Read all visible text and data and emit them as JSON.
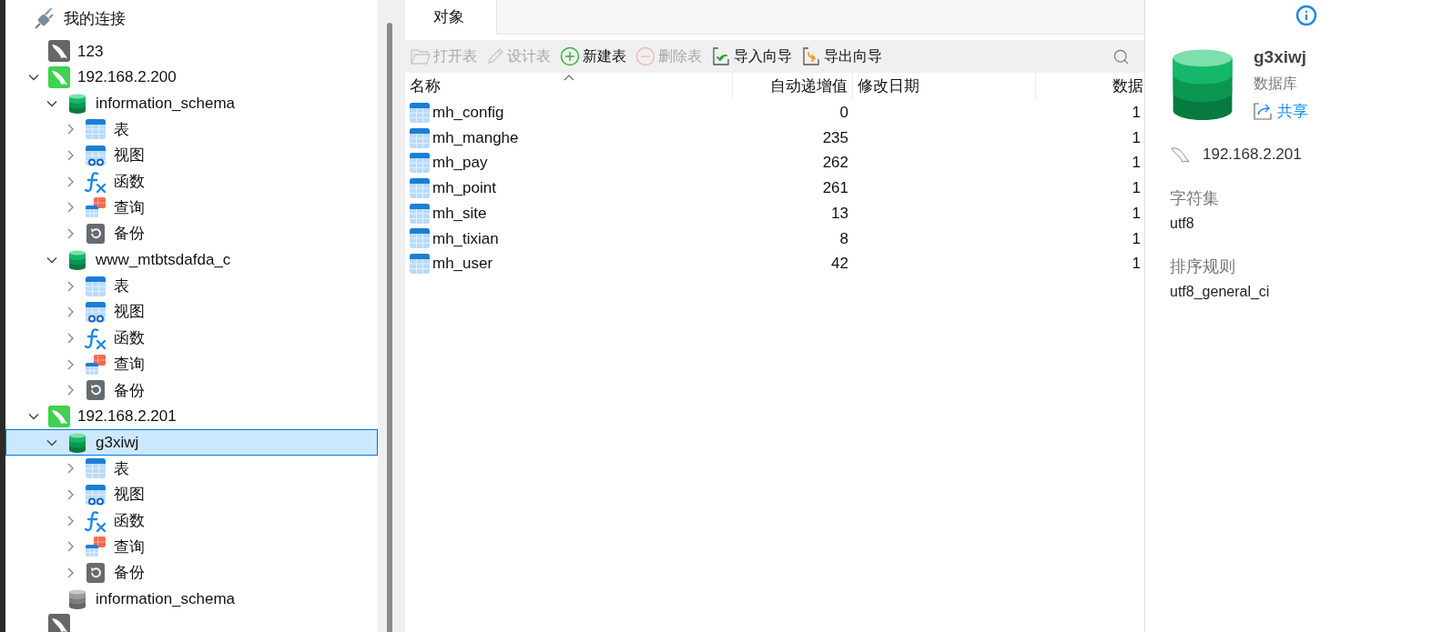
{
  "tree": {
    "root": {
      "label": "我的连接"
    },
    "items": [
      {
        "kind": "connection",
        "label": "123",
        "connected": false,
        "selected": false
      },
      {
        "kind": "connection",
        "label": "192.168.2.200",
        "connected": true,
        "expanded": true,
        "selected": false,
        "children": [
          {
            "kind": "database",
            "label": "information_schema",
            "open": true,
            "expanded": true,
            "selected": false,
            "children": [
              {
                "kind": "table",
                "label": "表",
                "expanded": false,
                "selected": false
              },
              {
                "kind": "view",
                "label": "视图",
                "expanded": false,
                "selected": false
              },
              {
                "kind": "function",
                "label": "函数",
                "expanded": false,
                "selected": false
              },
              {
                "kind": "query",
                "label": "查询",
                "expanded": false,
                "selected": false
              },
              {
                "kind": "backup",
                "label": "备份",
                "expanded": false,
                "selected": false
              }
            ]
          },
          {
            "kind": "database",
            "label": "www_mtbtsdafda_c",
            "open": true,
            "expanded": true,
            "selected": false,
            "children": [
              {
                "kind": "table",
                "label": "表",
                "expanded": false,
                "selected": false
              },
              {
                "kind": "view",
                "label": "视图",
                "expanded": false,
                "selected": false
              },
              {
                "kind": "function",
                "label": "函数",
                "expanded": false,
                "selected": false
              },
              {
                "kind": "query",
                "label": "查询",
                "expanded": false,
                "selected": false
              },
              {
                "kind": "backup",
                "label": "备份",
                "expanded": false,
                "selected": false
              }
            ]
          }
        ]
      },
      {
        "kind": "connection",
        "label": "192.168.2.201",
        "connected": true,
        "expanded": true,
        "selected": false,
        "children": [
          {
            "kind": "database",
            "label": "g3xiwj",
            "open": true,
            "expanded": true,
            "selected": true,
            "children": [
              {
                "kind": "table",
                "label": "表",
                "expanded": false,
                "selected": false
              },
              {
                "kind": "view",
                "label": "视图",
                "expanded": false,
                "selected": false
              },
              {
                "kind": "function",
                "label": "函数",
                "expanded": false,
                "selected": false
              },
              {
                "kind": "query",
                "label": "查询",
                "expanded": false,
                "selected": false
              },
              {
                "kind": "backup",
                "label": "备份",
                "expanded": false,
                "selected": false
              }
            ]
          },
          {
            "kind": "database",
            "label": "information_schema",
            "open": false,
            "selected": false
          }
        ]
      },
      {
        "kind": "connection",
        "connected": false,
        "selected": false
      }
    ]
  },
  "tabs": [
    {
      "label": "对象",
      "selected": true
    }
  ],
  "toolbar": [
    {
      "kind": "open",
      "label": "打开表",
      "disabled": true
    },
    {
      "kind": "design",
      "label": "设计表",
      "disabled": true
    },
    {
      "kind": "new",
      "label": "新建表",
      "disabled": false
    },
    {
      "kind": "delete",
      "label": "删除表",
      "disabled": true
    },
    {
      "kind": "import",
      "label": "导入向导",
      "disabled": false
    },
    {
      "kind": "export",
      "label": "导出向导",
      "disabled": false
    }
  ],
  "table": {
    "columns": [
      {
        "label": "名称",
        "kind": "text",
        "sorted": true
      },
      {
        "label": "自动递增值",
        "kind": "number",
        "sorted": false
      },
      {
        "label": "修改日期",
        "kind": "text",
        "sorted": false
      },
      {
        "label": "数据",
        "kind": "number",
        "sorted": false
      }
    ],
    "rows": [
      [
        "mh_config",
        "0",
        "",
        "1"
      ],
      [
        "mh_manghe",
        "235",
        "",
        "1"
      ],
      [
        "mh_pay",
        "262",
        "",
        "1"
      ],
      [
        "mh_point",
        "261",
        "",
        "1"
      ],
      [
        "mh_site",
        "13",
        "",
        "1"
      ],
      [
        "mh_tixian",
        "8",
        "",
        "1"
      ],
      [
        "mh_user",
        "42",
        "",
        "1"
      ]
    ]
  },
  "info": {
    "name": "g3xiwj",
    "type": "数据库",
    "share": "共享",
    "connection": "192.168.2.201",
    "fields": [
      {
        "label": "字符集",
        "value": "utf8"
      },
      {
        "label": "排序规则",
        "value": "utf8_general_ci"
      }
    ]
  }
}
